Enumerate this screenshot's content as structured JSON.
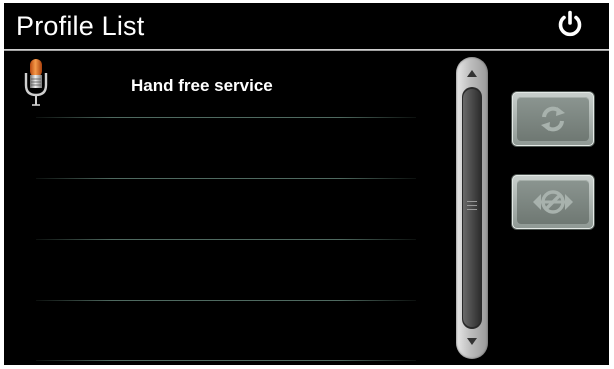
{
  "window": {
    "title": "Profile List"
  },
  "header": {
    "power_icon": "power-icon"
  },
  "profiles": [
    {
      "label": "Hand free service",
      "icon": "microphone-icon"
    },
    {
      "label": ""
    },
    {
      "label": ""
    },
    {
      "label": ""
    },
    {
      "label": ""
    }
  ],
  "scrollbar": {
    "up_icon": "arrow-up-icon",
    "down_icon": "arrow-down-icon",
    "thumb_icon": "grip-icon"
  },
  "side_buttons": [
    {
      "icon": "refresh-icon"
    },
    {
      "icon": "disconnect-icon"
    }
  ],
  "colors": {
    "background": "#000000",
    "text": "#ffffff",
    "mic_accent": "#e8762a",
    "button_face": "#7c8681"
  }
}
